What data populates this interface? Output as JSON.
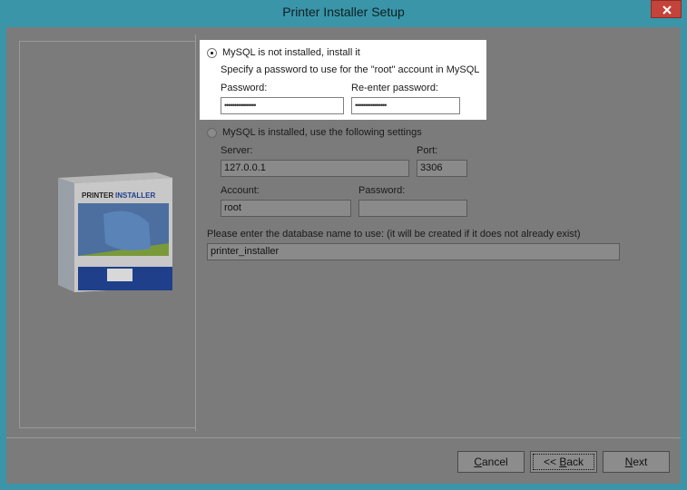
{
  "window": {
    "title": "Printer Installer Setup"
  },
  "option_install": {
    "label": "MySQL is not installed, install it",
    "description": "Specify a password to use for the \"root\" account in MySQL",
    "password_label": "Password:",
    "password_value": "••••••••••••••••",
    "reenter_label": "Re-enter password:",
    "reenter_value": "••••••••••••••••",
    "selected": true
  },
  "option_existing": {
    "label": "MySQL is installed, use the following settings",
    "server_label": "Server:",
    "server_value": "127.0.0.1",
    "port_label": "Port:",
    "port_value": "3306",
    "account_label": "Account:",
    "account_value": "root",
    "password_label": "Password:",
    "password_value": "",
    "selected": false
  },
  "database": {
    "label": "Please enter the database name to use:  (it will be created if it does not already exist)",
    "value": "printer_installer"
  },
  "product": {
    "brand_a": "PRINTER",
    "brand_b": "INSTALLER"
  },
  "buttons": {
    "cancel": {
      "first": "C",
      "rest": "ancel"
    },
    "back_prefix": "<< ",
    "back": {
      "first": "B",
      "rest": "ack"
    },
    "next": {
      "first": "N",
      "rest": "ext"
    }
  }
}
